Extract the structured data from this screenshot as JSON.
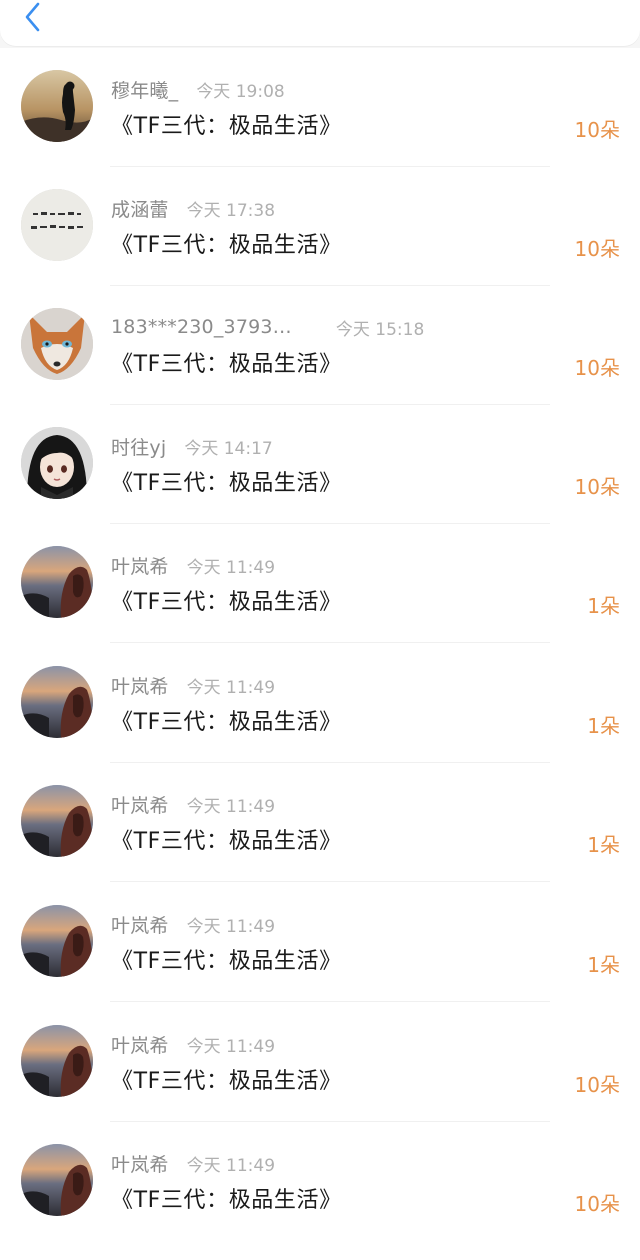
{
  "header": {
    "back_icon": "chevron-left-icon",
    "accent_color": "#3b8ff0"
  },
  "records": [
    {
      "username": "穆年曦_",
      "time": "今天 19:08",
      "title": "《TF三代：极品生活》",
      "amount": "10朵",
      "avatar": "sunset-figure"
    },
    {
      "username": "成涵蕾",
      "time": "今天 17:38",
      "title": "《TF三代：极品生活》",
      "amount": "10朵",
      "avatar": "calligraphy"
    },
    {
      "username": "183***230_3793…",
      "time": "今天 15:18",
      "title": "《TF三代：极品生活》",
      "amount": "10朵",
      "avatar": "fox"
    },
    {
      "username": "时往yj",
      "time": "今天 14:17",
      "title": "《TF三代：极品生活》",
      "amount": "10朵",
      "avatar": "anime-girl"
    },
    {
      "username": "叶岚希",
      "time": "今天 11:49",
      "title": "《TF三代：极品生活》",
      "amount": "1朵",
      "avatar": "seaside"
    },
    {
      "username": "叶岚希",
      "time": "今天 11:49",
      "title": "《TF三代：极品生活》",
      "amount": "1朵",
      "avatar": "seaside"
    },
    {
      "username": "叶岚希",
      "time": "今天 11:49",
      "title": "《TF三代：极品生活》",
      "amount": "1朵",
      "avatar": "seaside"
    },
    {
      "username": "叶岚希",
      "time": "今天 11:49",
      "title": "《TF三代：极品生活》",
      "amount": "1朵",
      "avatar": "seaside"
    },
    {
      "username": "叶岚希",
      "time": "今天 11:49",
      "title": "《TF三代：极品生活》",
      "amount": "10朵",
      "avatar": "seaside"
    },
    {
      "username": "叶岚希",
      "time": "今天 11:49",
      "title": "《TF三代：极品生活》",
      "amount": "10朵",
      "avatar": "seaside"
    }
  ],
  "colors": {
    "amount": "#e7924a",
    "username": "#8a8a8a",
    "time": "#b0b0b0"
  }
}
